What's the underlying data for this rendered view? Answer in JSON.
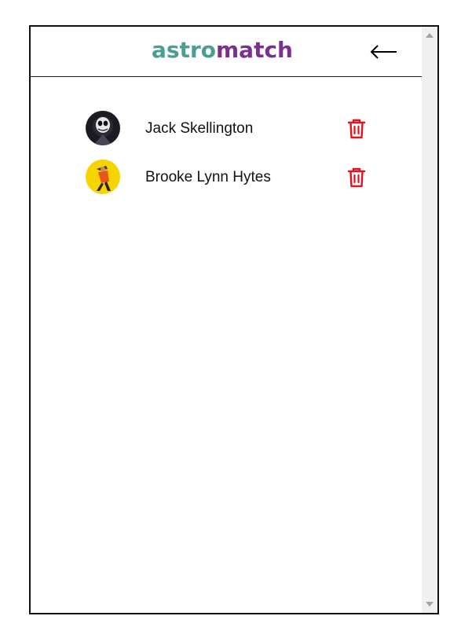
{
  "header": {
    "logo_part1": "astro",
    "logo_part2": "match",
    "back_icon": "arrow-left-icon",
    "colors": {
      "logo_teal": "#4a9e94",
      "logo_purple": "#7b2f8f"
    }
  },
  "matches": [
    {
      "name": "Jack Skellington",
      "avatar": "jack-skellington-avatar",
      "delete_icon": "trash-icon"
    },
    {
      "name": "Brooke Lynn Hytes",
      "avatar": "brooke-lynn-hytes-avatar",
      "delete_icon": "trash-icon"
    }
  ],
  "colors": {
    "delete": "#e0141e",
    "divider": "#222222"
  }
}
